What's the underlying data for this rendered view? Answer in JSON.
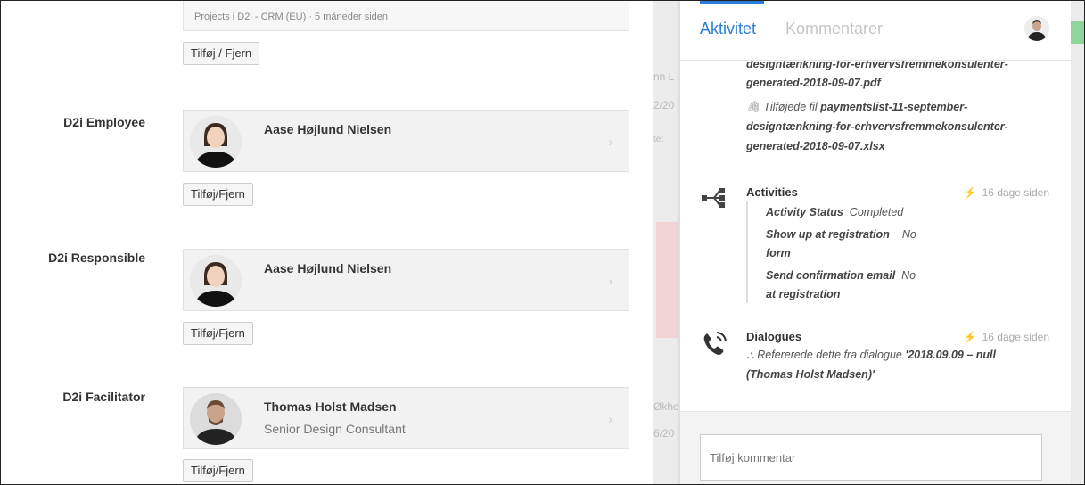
{
  "project": {
    "meta": "Projects i D2i - CRM (EU) · 5 måneder siden",
    "button": "Tilføj / Fjern"
  },
  "employee": {
    "label": "D2i Employee",
    "name": "Aase Højlund Nielsen",
    "button": "Tilføj/Fjern"
  },
  "responsible": {
    "label": "D2i Responsible",
    "name": "Aase Højlund Nielsen",
    "button": "Tilføj/Fjern"
  },
  "facilitator": {
    "label": "D2i Facilitator",
    "name": "Thomas Holst Madsen",
    "title": "Senior Design Consultant",
    "button": "Tilføj/Fjern"
  },
  "background": {
    "g1": "nn L",
    "g2": "2/20",
    "g3": "tet",
    "g4": "Økho",
    "g5": "6/20"
  },
  "panel": {
    "tabs": {
      "active": "Aktivitet",
      "inactive": "Kommentarer"
    },
    "file1": {
      "line1": "designtænkning-for-erhvervsfremmekonsulenter-",
      "line2": "generated-2018-09-07.pdf"
    },
    "file2": {
      "prefix": "Tilføjede fil ",
      "line1": "paymentslist-11-september-",
      "line2": "designtænkning-for-erhvervsfremmekonsulenter-",
      "line3": "generated-2018-09-07.xlsx"
    },
    "activities": {
      "title": "Activities",
      "time": "16 dage siden",
      "status_key": "Activity Status",
      "status_val": "Completed",
      "show_key1": "Show up at registration",
      "show_key2": "form",
      "show_val": "No",
      "send_key1": "Send confirmation email",
      "send_key2": "at registration",
      "send_val": "No"
    },
    "dialogues": {
      "title": "Dialogues",
      "time": "16 dage siden",
      "text": "Refererede dette fra dialogue ",
      "ref1": "'2018.09.09 – null",
      "ref2": "(Thomas Holst Madsen)'"
    },
    "comment_placeholder": "Tilføj kommentar"
  }
}
